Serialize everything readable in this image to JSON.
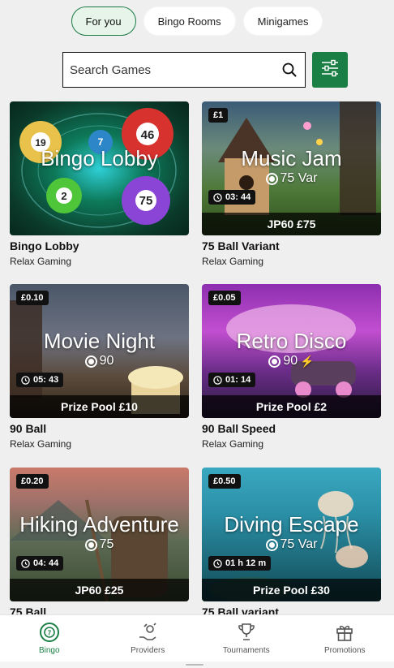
{
  "tabs": [
    {
      "label": "For you",
      "active": true
    },
    {
      "label": "Bingo Rooms",
      "active": false
    },
    {
      "label": "Minigames",
      "active": false
    }
  ],
  "search": {
    "placeholder": "Search Games",
    "icon": "search-icon"
  },
  "filter": {
    "icon": "sliders-icon"
  },
  "games": [
    {
      "title": "Bingo Lobby",
      "overlay_title": "Bingo Lobby",
      "type": "",
      "price": "",
      "timer": "",
      "pool": "",
      "provider": "Relax Gaming"
    },
    {
      "title": "75 Ball Variant",
      "overlay_title": "Music Jam",
      "type": "75 Var",
      "price": "£1",
      "timer": "03: 44",
      "pool": "JP60 £75",
      "provider": "Relax Gaming"
    },
    {
      "title": "90 Ball",
      "overlay_title": "Movie Night",
      "type": "90",
      "price": "£0.10",
      "timer": "05: 43",
      "pool": "Prize Pool £10",
      "provider": "Relax Gaming"
    },
    {
      "title": "90 Ball Speed",
      "overlay_title": "Retro Disco",
      "type": "90",
      "price": "£0.05",
      "timer": "01: 14",
      "pool": "Prize Pool £2",
      "provider": "Relax Gaming"
    },
    {
      "title": "75 Ball",
      "overlay_title": "Hiking Adventure",
      "type": "75",
      "price": "£0.20",
      "timer": "04: 44",
      "pool": "JP60 £25",
      "provider": ""
    },
    {
      "title": "75 Ball variant",
      "overlay_title": "Diving Escape",
      "type": "75 Var",
      "price": "£0.50",
      "timer": "01 h 12 m",
      "pool": "Prize Pool £30",
      "provider": ""
    }
  ],
  "bingo_balls": [
    "19",
    "46",
    "2",
    "75",
    "7"
  ],
  "nav": [
    {
      "label": "Bingo",
      "icon": "bingo-icon",
      "active": true
    },
    {
      "label": "Providers",
      "icon": "providers-icon",
      "active": false
    },
    {
      "label": "Tournaments",
      "icon": "trophy-icon",
      "active": false
    },
    {
      "label": "Promotions",
      "icon": "gift-icon",
      "active": false
    }
  ],
  "colors": {
    "brand_green": "#1a7f45",
    "active_tab_bg": "#e6f4ea"
  }
}
